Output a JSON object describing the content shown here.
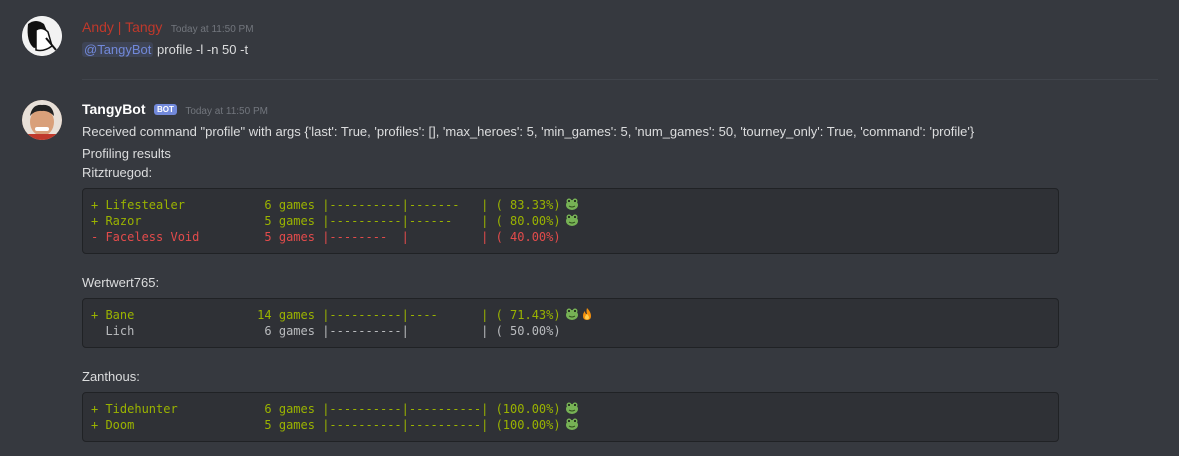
{
  "msg1": {
    "author": "Andy | Tangy",
    "author_color": "#c0392b",
    "timestamp": "Today at 11:50 PM",
    "mention": "@TangyBot",
    "command": "profile -l -n 50 -t"
  },
  "msg2": {
    "author": "TangyBot",
    "badge": "BOT",
    "timestamp": "Today at 11:50 PM",
    "line1": "Received command \"profile\" with args {'last': True, 'profiles': [], 'max_heroes': 5, 'min_games': 5, 'num_games': 50, 'tourney_only': True, 'command': 'profile'}",
    "line2": "Profiling results",
    "players": [
      {
        "name": "Ritztruegod:",
        "rows": [
          {
            "text": "+ Lifestealer           6 games |----------|-------   | ( 83.33%)",
            "emoji": [
              "frog-icon"
            ]
          },
          {
            "text": "+ Razor                 5 games |----------|------    | ( 80.00%)",
            "emoji": [
              "frog-icon"
            ]
          },
          {
            "text": "- Faceless Void         5 games |--------  |          | ( 40.00%)",
            "emoji": []
          }
        ]
      },
      {
        "name": "Wertwert765:",
        "rows": [
          {
            "text": "+ Bane                 14 games |----------|----      | ( 71.43%)",
            "emoji": [
              "frog-icon",
              "fire-icon"
            ]
          },
          {
            "text": "  Lich                  6 games |----------|          | ( 50.00%)",
            "emoji": []
          }
        ]
      },
      {
        "name": "Zanthous:",
        "rows": [
          {
            "text": "+ Tidehunter            6 games |----------|----------| (100.00%)",
            "emoji": [
              "frog-icon"
            ]
          },
          {
            "text": "+ Doom                  5 games |----------|----------| (100.00%)",
            "emoji": [
              "frog-icon"
            ]
          }
        ]
      }
    ]
  },
  "colors": {
    "positive": "#9ab300",
    "negative": "#e34b4b",
    "neutral": "#b9bbbe",
    "mention": "#7289da"
  }
}
